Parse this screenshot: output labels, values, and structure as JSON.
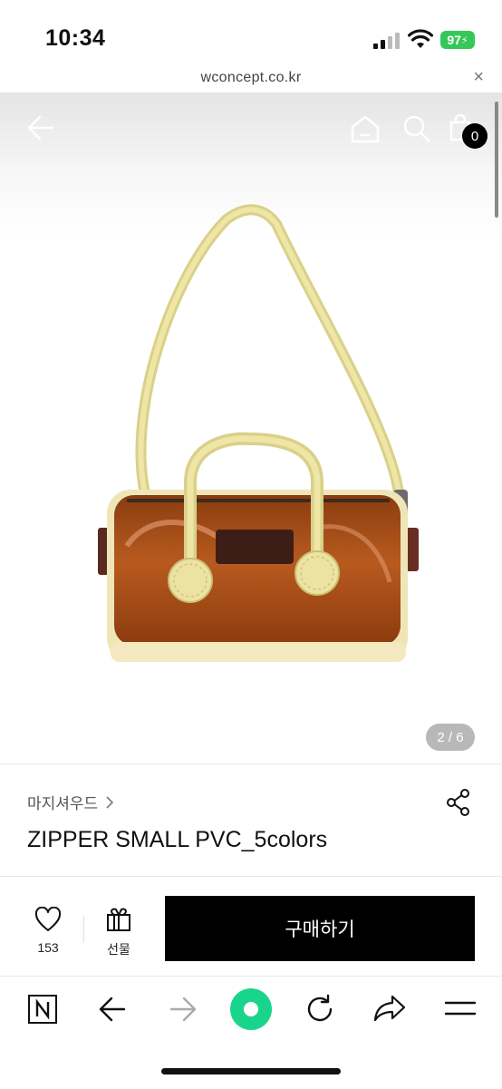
{
  "status": {
    "time": "10:34",
    "battery": "97"
  },
  "browser_top": {
    "url": "wconcept.co.kr",
    "close_glyph": "×"
  },
  "header": {
    "cart_count": "0"
  },
  "gallery": {
    "counter": "2 / 6"
  },
  "product": {
    "brand": "마지셔우드",
    "name": "ZIPPER SMALL PVC_5colors"
  },
  "actions": {
    "like_count": "153",
    "gift_label": "선물",
    "buy_label": "구매하기"
  },
  "colors": {
    "accent_green": "#19d58b",
    "buy_bg": "#000000",
    "battery_green": "#34c759"
  },
  "icons": [
    "back-arrow-icon",
    "home-icon",
    "search-icon",
    "shopping-bag-icon",
    "share-icon",
    "heart-icon",
    "gift-icon",
    "naver-n-icon",
    "browser-back-icon",
    "browser-forward-icon",
    "refresh-icon",
    "share-arrow-icon",
    "menu-icon"
  ]
}
